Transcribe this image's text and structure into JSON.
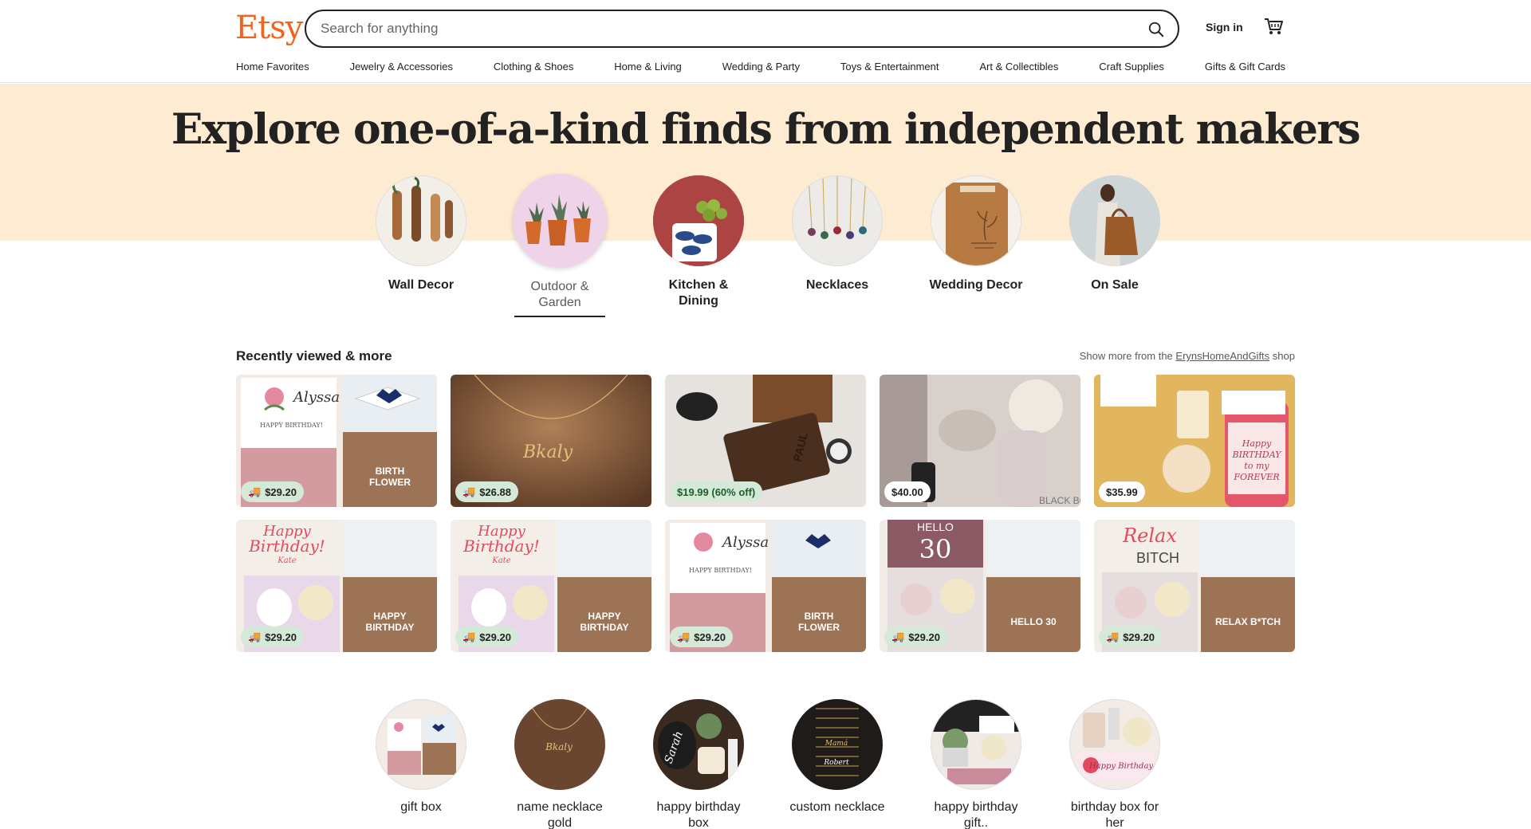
{
  "header": {
    "logo": "Etsy",
    "search_placeholder": "Search for anything",
    "signin": "Sign in",
    "nav": [
      "Home Favorites",
      "Jewelry & Accessories",
      "Clothing & Shoes",
      "Home & Living",
      "Wedding & Party",
      "Toys & Entertainment",
      "Art & Collectibles",
      "Craft Supplies",
      "Gifts & Gift Cards"
    ]
  },
  "hero": {
    "title": "Explore one-of-a-kind finds from independent makers",
    "categories": [
      {
        "label": "Wall Decor"
      },
      {
        "label": "Outdoor & Garden"
      },
      {
        "label": "Kitchen & Dining"
      },
      {
        "label": "Necklaces"
      },
      {
        "label": "Wedding Decor"
      },
      {
        "label": "On Sale"
      }
    ]
  },
  "recently_viewed": {
    "title": "Recently viewed & more",
    "more_prefix": "Show more from the",
    "shop_name": "ErynsHomeAndGifts",
    "more_suffix": "shop",
    "items": [
      {
        "price": "$29.20",
        "shipping_icon": true,
        "img_text": "BIRTH FLOWER"
      },
      {
        "price": "$26.88",
        "shipping_icon": true,
        "img_text": "Bkaly"
      },
      {
        "price": "$19.99 (60% off)",
        "sale": true,
        "img_text": "PAUL"
      },
      {
        "price": "$40.00",
        "img_text": ""
      },
      {
        "price": "$35.99",
        "img_text": "Happy BIRTHDAY to my FOREVER"
      },
      {
        "price": "$29.20",
        "shipping_icon": true,
        "img_text": "HAPPY BIRTHDAY"
      },
      {
        "price": "$29.20",
        "shipping_icon": true,
        "img_text": "HAPPY BIRTHDAY"
      },
      {
        "price": "$29.20",
        "shipping_icon": true,
        "img_text": "BIRTH FLOWER"
      },
      {
        "price": "$29.20",
        "shipping_icon": true,
        "img_text": "HELLO 30"
      },
      {
        "price": "$29.20",
        "shipping_icon": true,
        "img_text": "RELAX B*TCH"
      }
    ]
  },
  "popular": [
    {
      "label": "gift box"
    },
    {
      "label": "name necklace gold"
    },
    {
      "label": "happy birthday box"
    },
    {
      "label": "custom necklace"
    },
    {
      "label": "happy birthday gift.."
    },
    {
      "label": "birthday box for her"
    }
  ],
  "colors": {
    "brand": "#f1641e",
    "hero_bg": "#fdebd2",
    "sale_bg": "#d4e9d7"
  }
}
